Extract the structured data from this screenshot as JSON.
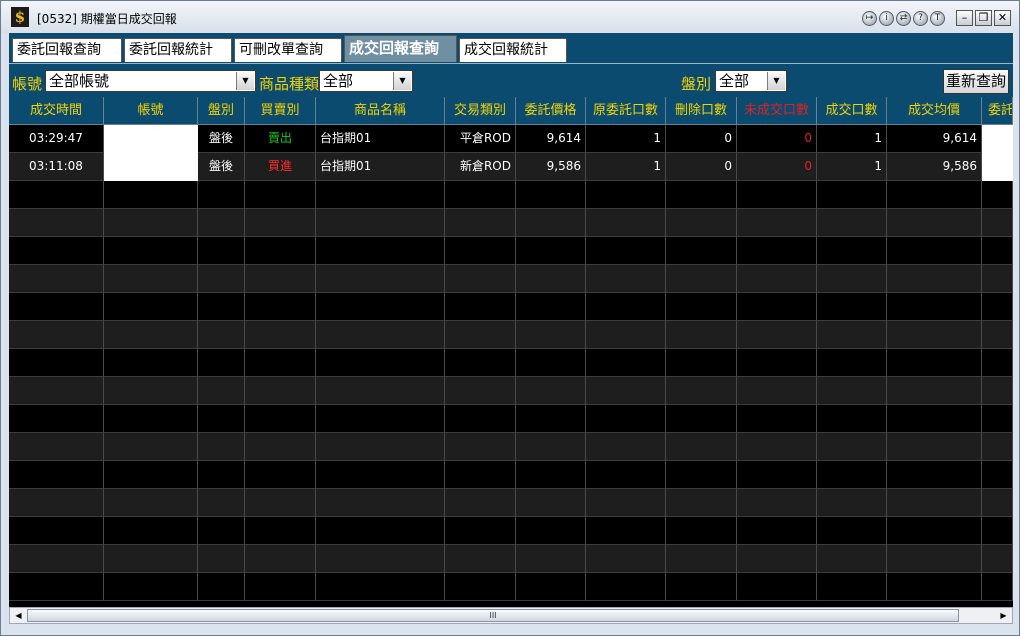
{
  "window": {
    "title": "[0532] 期權當日成交回報",
    "app_icon": "$"
  },
  "title_icons": [
    "↦",
    "i",
    "⇄",
    "?",
    "T"
  ],
  "window_buttons": {
    "minimize": "–",
    "maximize": "❐",
    "close": "✕"
  },
  "tabs": [
    {
      "label": "委託回報查詢",
      "active": false
    },
    {
      "label": "委託回報統計",
      "active": false
    },
    {
      "label": "可刪改單查詢",
      "active": false
    },
    {
      "label": "成交回報查詢",
      "active": true
    },
    {
      "label": "成交回報統計",
      "active": false
    }
  ],
  "filters": {
    "account_label": "帳號",
    "account_value": "全部帳號",
    "product_label": "商品種類",
    "product_value": "全部",
    "session_label": "盤別",
    "session_value": "全部",
    "requery_label": "重新查詢"
  },
  "table": {
    "headers": [
      "成交時間",
      "帳號",
      "盤別",
      "買賣別",
      "商品名稱",
      "交易類別",
      "委託價格",
      "原委託口數",
      "刪除口數",
      "未成交口數",
      "成交口數",
      "成交均價",
      "委託"
    ],
    "rows": [
      {
        "time": "03:29:47",
        "account": "",
        "session": "盤後",
        "side": "賣出",
        "product": "台指期01",
        "trade_type": "平倉ROD",
        "order_price": "9,614",
        "orig_qty": "1",
        "del_qty": "0",
        "unfilled_qty": "0",
        "filled_qty": "1",
        "avg_price": "9,614",
        "extra": ""
      },
      {
        "time": "03:11:08",
        "account": "",
        "session": "盤後",
        "side": "買進",
        "product": "台指期01",
        "trade_type": "新倉ROD",
        "order_price": "9,586",
        "orig_qty": "1",
        "del_qty": "0",
        "unfilled_qty": "0",
        "filled_qty": "1",
        "avg_price": "9,586",
        "extra": ""
      }
    ]
  },
  "colors": {
    "sell": "#19c819",
    "buy": "#ff2a2a",
    "unfilled": "#e02020",
    "header_text": "#f2d300",
    "bar_bg": "#0c4b70"
  },
  "scrollbar": {
    "grip": "III",
    "left_arrow": "◀",
    "right_arrow": "▶"
  }
}
